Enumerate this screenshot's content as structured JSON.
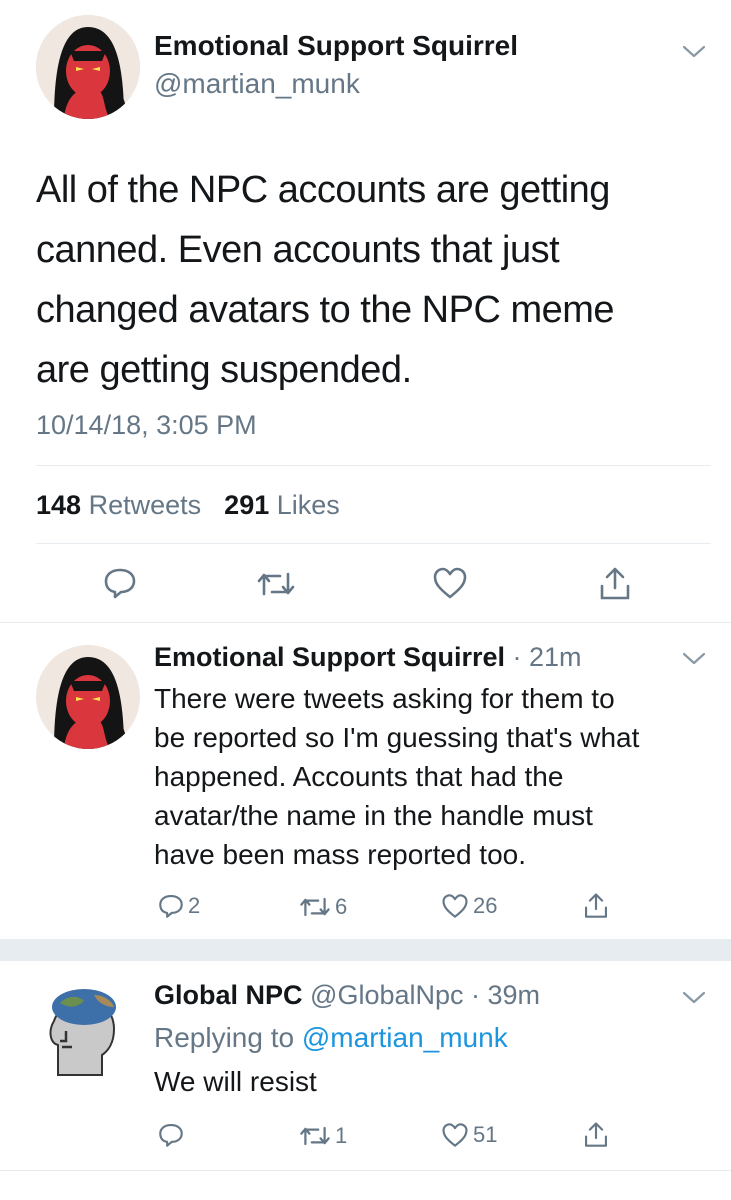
{
  "main_tweet": {
    "author_name": "Emotional Support Squirrel",
    "handle": "@martian_munk",
    "text_lines": [
      "All of the NPC accounts are getting",
      "canned. Even accounts that just",
      "changed avatars to the NPC meme",
      "are getting suspended."
    ],
    "timestamp": "10/14/18, 3:05 PM",
    "retweets_count": "148",
    "retweets_label": "Retweets",
    "likes_count": "291",
    "likes_label": "Likes"
  },
  "reply1": {
    "author_name": "Emotional Support Squirrel",
    "meta": "· 21m",
    "text_lines": [
      "There were tweets asking for them to",
      "be reported so I'm guessing that's what",
      "happened. Accounts that had the",
      "avatar/the name in the handle must",
      "have been mass reported too."
    ],
    "reply_count": "2",
    "retweet_count": "6",
    "like_count": "26"
  },
  "reply2": {
    "author_name": "Global NPC",
    "handle": "@GlobalNpc",
    "meta": "· 39m",
    "replying_prefix": "Replying to",
    "replying_handle": "@martian_munk",
    "text": "We will resist",
    "retweet_count": "1",
    "like_count": "51"
  },
  "colors": {
    "text": "#14171a",
    "secondary": "#657786",
    "link": "#1b95e0",
    "divider": "#e6ecf0"
  }
}
